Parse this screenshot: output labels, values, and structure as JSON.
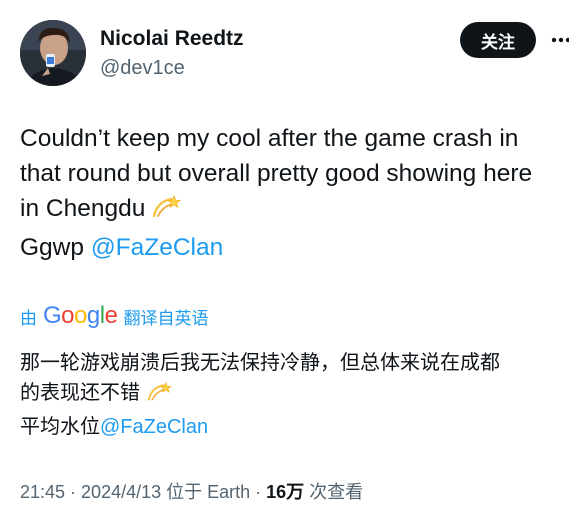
{
  "user": {
    "name": "Nicolai Reedtz",
    "handle": "@dev1ce"
  },
  "header": {
    "follow_label": "关注",
    "more_icon": "more-horizontal-icon"
  },
  "tweet": {
    "line1": "Couldn’t keep my cool after the game crash in",
    "line2": "that round but overall pretty good showing here",
    "line3": "in Chengdu",
    "line4_prefix": "Ggwp ",
    "mention": "@FaZeClan",
    "emoji_icon": "dizzy-icon"
  },
  "translation": {
    "prefix": "由",
    "google": {
      "g1": "G",
      "o1": "o",
      "o2": "o",
      "g2": "g",
      "l": "l",
      "e": "e"
    },
    "suffix": "翻译自英语",
    "line1": "那一轮游戏崩溃后我无法保持冷静，但总体来说在成都",
    "line2": "的表现还不错",
    "line3_prefix": "平均水位",
    "mention": "@FaZeClan"
  },
  "meta": {
    "time": "21:45",
    "sep1": " · ",
    "date": "2024/4/13",
    "location": " 位于 Earth",
    "sep2": " · ",
    "views_count": "16万",
    "views_label": " 次查看"
  },
  "colors": {
    "accent": "#1d9bf0",
    "text": "#0f1419",
    "secondary": "#536471",
    "button_bg": "#0f1419"
  }
}
